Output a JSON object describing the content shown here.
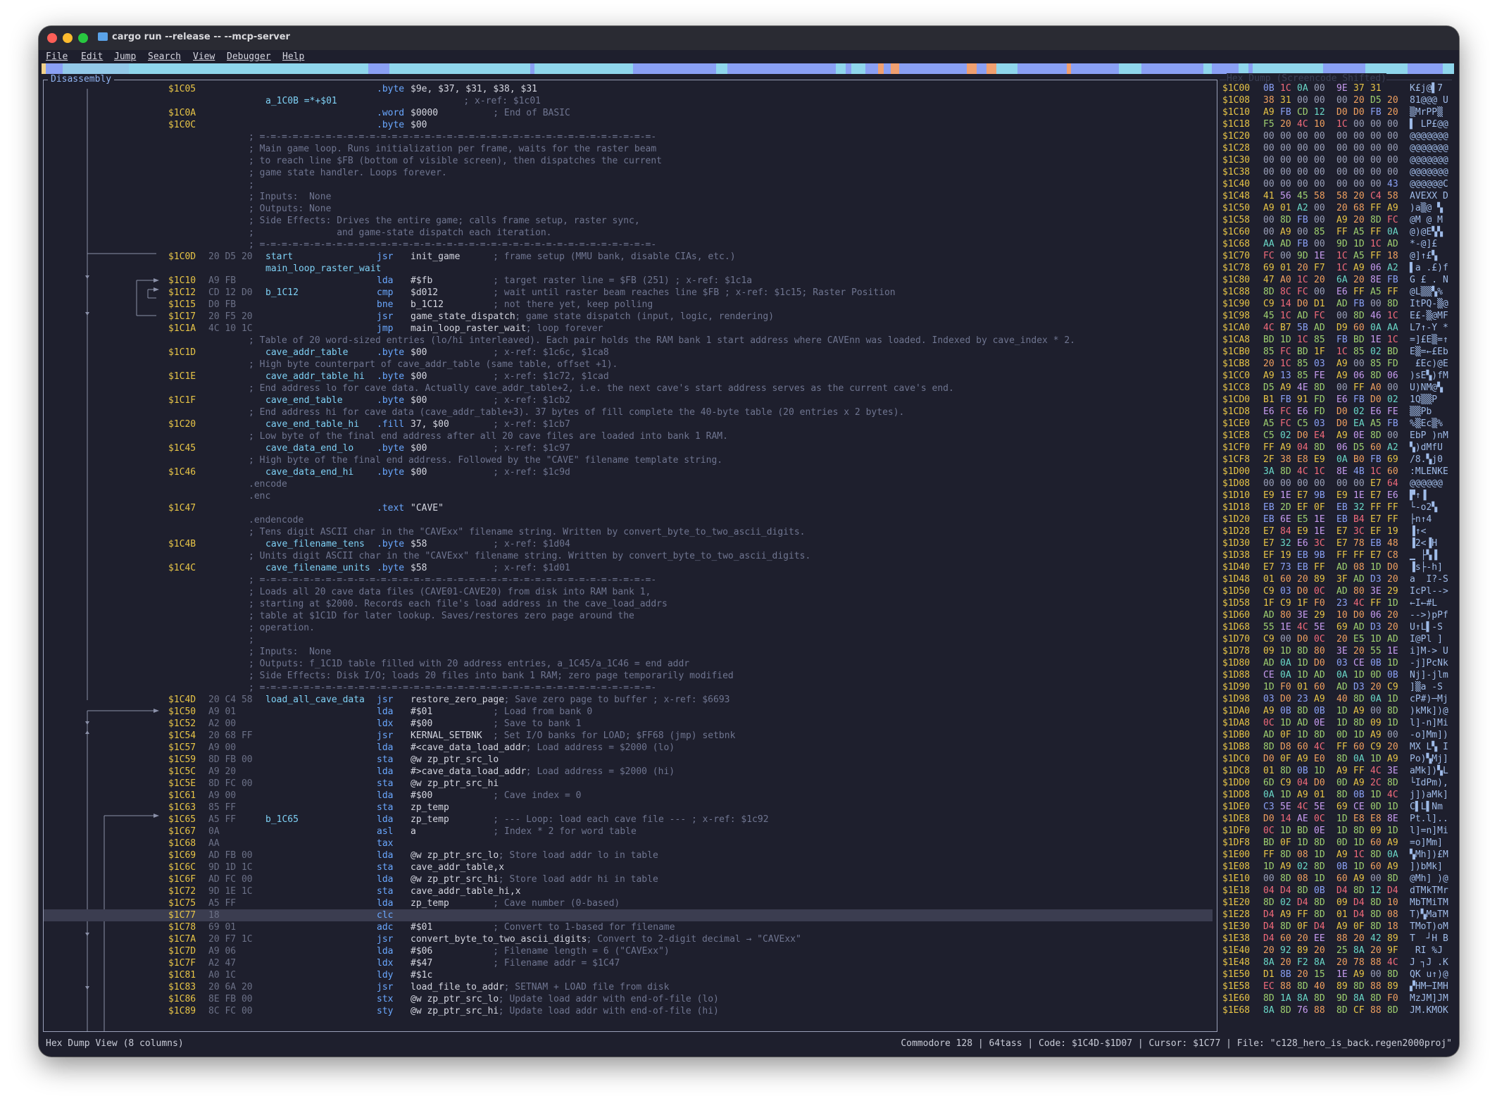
{
  "window": {
    "title": "cargo run --release -- --mcp-server"
  },
  "menu": [
    "File",
    "Edit",
    "Jump",
    "Search",
    "View",
    "Debugger",
    "Help"
  ],
  "panels": {
    "disassembly": "Disassembly",
    "hexdump": "Hex Dump (Screencode Shifted)"
  },
  "colors": {
    "address": "#e8c547",
    "label": "#7fd1f5",
    "mnemonic": "#6aa8ff",
    "comment": "#6f7590",
    "bytes": "#6b7086",
    "band": "#8aa0f4"
  },
  "lines": [
    {
      "a": "$1C05",
      "b": "",
      "l": "",
      "m": ".byte",
      "o": "$9e, $37, $31, $38, $31",
      "c": ""
    },
    {
      "a": "",
      "b": "",
      "l": "a_1C0B =*+$01",
      "m": "",
      "o": "",
      "c": "                       ; x-ref: $1c01"
    },
    {
      "a": "$1C0A",
      "b": "",
      "l": "",
      "m": ".word",
      "o": "$0000",
      "c": "          ; End of BASIC"
    },
    {
      "a": "$1C0C",
      "b": "",
      "l": "",
      "m": ".byte",
      "o": "$00",
      "c": ""
    },
    {
      "d": "; =-=-=-=-=-=-=-=-=-=-=-=-=-=-=-=-=-=-=-=-=-=-=-=-=-=-=-=-=-=-=-=-=-=-=-=-"
    },
    {
      "d": "; Main game loop. Runs initialization per frame, waits for the raster beam"
    },
    {
      "d": "; to reach line $FB (bottom of visible screen), then dispatches the current"
    },
    {
      "d": "; game state handler. Loops forever."
    },
    {
      "d": ";"
    },
    {
      "d": "; Inputs:  None"
    },
    {
      "d": "; Outputs: None"
    },
    {
      "d": "; Side Effects: Drives the entire game; calls frame setup, raster sync,"
    },
    {
      "d": ";               and game-state dispatch each iteration."
    },
    {
      "d": "; =-=-=-=-=-=-=-=-=-=-=-=-=-=-=-=-=-=-=-=-=-=-=-=-=-=-=-=-=-=-=-=-=-=-=-=-"
    },
    {
      "a": "$1C0D",
      "b": "20 D5 20",
      "l": "start",
      "m": "jsr",
      "o": "init_game",
      "c": "      ; frame setup (MMU bank, disable CIAs, etc.)"
    },
    {
      "a": "",
      "b": "",
      "l": "main_loop_raster_wait",
      "m": "",
      "o": "",
      "c": ""
    },
    {
      "a": "$1C10",
      "b": "A9 FB",
      "l": "",
      "m": "lda",
      "o": "#$fb",
      "c": "           ; target raster line = $FB (251) ; x-ref: $1c1a"
    },
    {
      "a": "$1C12",
      "b": "CD 12 D0",
      "l": "b_1C12",
      "m": "cmp",
      "o": "$d012",
      "c": "          ; wait until raster beam reaches line $FB ; x-ref: $1c15; Raster Position"
    },
    {
      "a": "$1C15",
      "b": "D0 FB",
      "l": "",
      "m": "bne",
      "o": "b_1C12",
      "c": "         ; not there yet, keep polling"
    },
    {
      "a": "$1C17",
      "b": "20 F5 20",
      "l": "",
      "m": "jsr",
      "o": "game_state_dispatch",
      "c": "; game state dispatch (input, logic, rendering)"
    },
    {
      "a": "$1C1A",
      "b": "4C 10 1C",
      "l": "",
      "m": "jmp",
      "o": "main_loop_raster_wait",
      "c": "; loop forever"
    },
    {
      "d": "; Table of 20 word-sized entries (lo/hi interleaved). Each pair holds the RAM bank 1 start address where CAVEnn was loaded. Indexed by cave_index * 2."
    },
    {
      "a": "$1C1D",
      "b": "",
      "l": "cave_addr_table",
      "m": ".byte",
      "o": "$00",
      "c": "            ; x-ref: $1c6c, $1ca8"
    },
    {
      "d": "; High byte counterpart of cave_addr_table (same table, offset +1)."
    },
    {
      "a": "$1C1E",
      "b": "",
      "l": "cave_addr_table_hi",
      "m": ".byte",
      "o": "$00",
      "c": "            ; x-ref: $1c72, $1cad"
    },
    {
      "d": "; End address lo for cave data. Actually cave_addr_table+2, i.e. the next cave's start address serves as the current cave's end."
    },
    {
      "a": "$1C1F",
      "b": "",
      "l": "cave_end_table",
      "m": ".byte",
      "o": "$00",
      "c": "            ; x-ref: $1cb2"
    },
    {
      "d": "; End address hi for cave data (cave_addr_table+3). 37 bytes of fill complete the 40-byte table (20 entries x 2 bytes)."
    },
    {
      "a": "$1C20",
      "b": "",
      "l": "cave_end_table_hi",
      "m": ".fill",
      "o": "37, $00",
      "c": "        ; x-ref: $1cb7"
    },
    {
      "d": "; Low byte of the final end address after all 20 cave files are loaded into bank 1 RAM."
    },
    {
      "a": "$1C45",
      "b": "",
      "l": "cave_data_end_lo",
      "m": ".byte",
      "o": "$00",
      "c": "            ; x-ref: $1c97"
    },
    {
      "d": "; High byte of the final end address. Followed by the \"CAVE\" filename template string."
    },
    {
      "a": "$1C46",
      "b": "",
      "l": "cave_data_end_hi",
      "m": ".byte",
      "o": "$00",
      "c": "            ; x-ref: $1c9d"
    },
    {
      "d": ".encode"
    },
    {
      "d": ".enc"
    },
    {
      "a": "$1C47",
      "b": "",
      "l": "",
      "m": ".text",
      "o": "\"CAVE\"",
      "c": ""
    },
    {
      "d": ".endencode"
    },
    {
      "d": "; Tens digit ASCII char in the \"CAVExx\" filename string. Written by convert_byte_to_two_ascii_digits."
    },
    {
      "a": "$1C4B",
      "b": "",
      "l": "cave_filename_tens",
      "m": ".byte",
      "o": "$58",
      "c": "            ; x-ref: $1d04"
    },
    {
      "d": "; Units digit ASCII char in the \"CAVExx\" filename string. Written by convert_byte_to_two_ascii_digits."
    },
    {
      "a": "$1C4C",
      "b": "",
      "l": "cave_filename_units",
      "m": ".byte",
      "o": "$58",
      "c": "            ; x-ref: $1d01"
    },
    {
      "d": "; =-=-=-=-=-=-=-=-=-=-=-=-=-=-=-=-=-=-=-=-=-=-=-=-=-=-=-=-=-=-=-=-=-=-=-=-"
    },
    {
      "d": "; Loads all 20 cave data files (CAVE01-CAVE20) from disk into RAM bank 1,"
    },
    {
      "d": "; starting at $2000. Records each file's load address in the cave_load_addrs"
    },
    {
      "d": "; table at $1C1D for later lookup. Saves/restores zero page around the"
    },
    {
      "d": "; operation."
    },
    {
      "d": ";"
    },
    {
      "d": "; Inputs:  None"
    },
    {
      "d": "; Outputs: f_1C1D table filled with 20 address entries, a_1C45/a_1C46 = end addr"
    },
    {
      "d": "; Side Effects: Disk I/O; loads 20 files into bank 1 RAM; zero page temporarily modified"
    },
    {
      "d": "; =-=-=-=-=-=-=-=-=-=-=-=-=-=-=-=-=-=-=-=-=-=-=-=-=-=-=-=-=-=-=-=-=-=-=-=-"
    },
    {
      "a": "$1C4D",
      "b": "20 C4 58",
      "l": "load_all_cave_data",
      "m": "jsr",
      "o": "restore_zero_page",
      "c": "; Save zero page to buffer ; x-ref: $6693"
    },
    {
      "a": "$1C50",
      "b": "A9 01",
      "l": "",
      "m": "lda",
      "o": "#$01",
      "c": "           ; Load from bank 0"
    },
    {
      "a": "$1C52",
      "b": "A2 00",
      "l": "",
      "m": "ldx",
      "o": "#$00",
      "c": "           ; Save to bank 1"
    },
    {
      "a": "$1C54",
      "b": "20 68 FF",
      "l": "",
      "m": "jsr",
      "o": "KERNAL_SETBNK",
      "c": "  ; Set I/O banks for LOAD; $FF68 (jmp) setbnk"
    },
    {
      "a": "$1C57",
      "b": "A9 00",
      "l": "",
      "m": "lda",
      "o": "#<cave_data_load_addr",
      "c": "; Load address = $2000 (lo)"
    },
    {
      "a": "$1C59",
      "b": "8D FB 00",
      "l": "",
      "m": "sta",
      "o": "@w zp_ptr_src_lo",
      "c": ""
    },
    {
      "a": "$1C5C",
      "b": "A9 20",
      "l": "",
      "m": "lda",
      "o": "#>cave_data_load_addr",
      "c": "; Load address = $2000 (hi)"
    },
    {
      "a": "$1C5E",
      "b": "8D FC 00",
      "l": "",
      "m": "sta",
      "o": "@w zp_ptr_src_hi",
      "c": ""
    },
    {
      "a": "$1C61",
      "b": "A9 00",
      "l": "",
      "m": "lda",
      "o": "#$00",
      "c": "           ; Cave index = 0"
    },
    {
      "a": "$1C63",
      "b": "85 FF",
      "l": "",
      "m": "sta",
      "o": "zp_temp",
      "c": ""
    },
    {
      "a": "$1C65",
      "b": "A5 FF",
      "l": "b_1C65",
      "m": "lda",
      "o": "zp_temp",
      "c": "        ; --- Loop: load each cave file --- ; x-ref: $1c92"
    },
    {
      "a": "$1C67",
      "b": "0A",
      "l": "",
      "m": "asl",
      "o": "a",
      "c": "              ; Index * 2 for word table"
    },
    {
      "a": "$1C68",
      "b": "AA",
      "l": "",
      "m": "tax",
      "o": "",
      "c": ""
    },
    {
      "a": "$1C69",
      "b": "AD FB 00",
      "l": "",
      "m": "lda",
      "o": "@w zp_ptr_src_lo",
      "c": "; Store load addr lo in table"
    },
    {
      "a": "$1C6C",
      "b": "9D 1D 1C",
      "l": "",
      "m": "sta",
      "o": "cave_addr_table,x",
      "c": ""
    },
    {
      "a": "$1C6F",
      "b": "AD FC 00",
      "l": "",
      "m": "lda",
      "o": "@w zp_ptr_src_hi",
      "c": "; Store load addr hi in table"
    },
    {
      "a": "$1C72",
      "b": "9D 1E 1C",
      "l": "",
      "m": "sta",
      "o": "cave_addr_table_hi,x",
      "c": ""
    },
    {
      "a": "$1C75",
      "b": "A5 FF",
      "l": "",
      "m": "lda",
      "o": "zp_temp",
      "c": "        ; Cave number (0-based)"
    },
    {
      "a": "$1C77",
      "b": "18",
      "l": "",
      "m": "clc",
      "o": "",
      "c": "",
      "hl": true
    },
    {
      "a": "$1C78",
      "b": "69 01",
      "l": "",
      "m": "adc",
      "o": "#$01",
      "c": "           ; Convert to 1-based for filename"
    },
    {
      "a": "$1C7A",
      "b": "20 F7 1C",
      "l": "",
      "m": "jsr",
      "o": "convert_byte_to_two_ascii_digits",
      "c": "; Convert to 2-digit decimal → \"CAVExx\""
    },
    {
      "a": "$1C7D",
      "b": "A9 06",
      "l": "",
      "m": "lda",
      "o": "#$06",
      "c": "           ; Filename length = 6 (\"CAVExx\")"
    },
    {
      "a": "$1C7F",
      "b": "A2 47",
      "l": "",
      "m": "ldx",
      "o": "#$47",
      "c": "           ; Filename addr = $1C47"
    },
    {
      "a": "$1C81",
      "b": "A0 1C",
      "l": "",
      "m": "ldy",
      "o": "#$1c",
      "c": ""
    },
    {
      "a": "$1C83",
      "b": "20 6A 20",
      "l": "",
      "m": "jsr",
      "o": "load_file_to_addr",
      "c": "; SETNAM + LOAD file from disk"
    },
    {
      "a": "$1C86",
      "b": "8E FB 00",
      "l": "",
      "m": "stx",
      "o": "@w zp_ptr_src_lo",
      "c": "; Update load addr with end-of-file (lo)"
    },
    {
      "a": "$1C89",
      "b": "8C FC 00",
      "l": "",
      "m": "sty",
      "o": "@w zp_ptr_src_hi",
      "c": "; Update load addr with end-of-file (hi)"
    }
  ],
  "hex": [
    [
      "$1C00",
      "0B 1C 0A 00 9E 37 31",
      "K£j@▌7"
    ],
    [
      "$1C08",
      "38 31 00 00 00 20 D5 20",
      "81@@@ U"
    ],
    [
      "$1C10",
      "A9 FB CD 12 D0 D0 FB 20",
      "▒MrPP▒"
    ],
    [
      "$1C18",
      "F5 20 4C 10 1C 00 00 00",
      "▌ LP£@@"
    ],
    [
      "$1C20",
      "00 00 00 00 00 00 00 00",
      "@@@@@@@"
    ],
    [
      "$1C28",
      "00 00 00 00 00 00 00 00",
      "@@@@@@@"
    ],
    [
      "$1C30",
      "00 00 00 00 00 00 00 00",
      "@@@@@@@"
    ],
    [
      "$1C38",
      "00 00 00 00 00 00 00 00",
      "@@@@@@@"
    ],
    [
      "$1C40",
      "00 00 00 00 00 00 00 43",
      "@@@@@@C"
    ],
    [
      "$1C48",
      "41 56 45 58 58 20 C4 58",
      "AVEXX D"
    ],
    [
      "$1C50",
      "A9 01 A2 00 20 68 FF A9",
      ")a▒@ ▚"
    ],
    [
      "$1C58",
      "00 8D FB 00 A9 20 8D FC",
      "@M @ M"
    ],
    [
      "$1C60",
      "00 A9 00 85 FF A5 FF 0A",
      "@)@E▚▚"
    ],
    [
      "$1C68",
      "AA AD FB 00 9D 1D 1C AD",
      "*-@]£"
    ],
    [
      "$1C70",
      "FC 00 9D 1E 1C A5 FF 18",
      "@]↑£▚"
    ],
    [
      "$1C78",
      "69 01 20 F7 1C A9 06 A2",
      "▌a .£)f"
    ],
    [
      "$1C80",
      "47 A0 1C 20 6A 20 8E FB",
      "G £ . N"
    ],
    [
      "$1C88",
      "8D 8C FC 00 E6 FF A5 FF",
      "@L▒▒▚%"
    ],
    [
      "$1C90",
      "C9 14 D0 D1 AD FB 00 8D",
      "ItPQ-▒@"
    ],
    [
      "$1C98",
      "45 1C AD FC 00 8D 46 1C",
      "E£-▒@MF"
    ],
    [
      "$1CA0",
      "4C B7 5B AD D9 60 0A AA",
      "L7↑-Y *"
    ],
    [
      "$1CA8",
      "BD 1D 1C 85 FB BD 1E 1C",
      "=]£E▒=↑"
    ],
    [
      "$1CB0",
      "85 FC BD 1F 1C 85 02 BD",
      "E▒=←£Eb"
    ],
    [
      "$1CB8",
      "20 1C 85 03 A9 00 85 FD",
      " £Ec)@E"
    ],
    [
      "$1CC0",
      "A9 13 85 FE A9 06 8D 06",
      ")sE▚)fM"
    ],
    [
      "$1CC8",
      "D5 A9 4E 8D 00 FF A0 00",
      "U)NM@▚"
    ],
    [
      "$1CD0",
      "B1 FB 91 FD E6 FB D0 02",
      "1Q▒▒P"
    ],
    [
      "$1CD8",
      "E6 FC E6 FD D0 02 E6 FE",
      "▒▒Pb"
    ],
    [
      "$1CE0",
      "A5 FC C5 03 D0 EA A5 FB",
      "%▒Ec▒%"
    ],
    [
      "$1CE8",
      "C5 02 D0 E4 A9 0E 8D 00",
      "EbP )nM"
    ],
    [
      "$1CF0",
      "FF A9 04 8D 06 D5 60 A2",
      "▚)dMfU"
    ],
    [
      "$1CF8",
      "2F 38 E8 E9 0A B0 FB 69",
      "/8.▚j0"
    ],
    [
      "$1D00",
      "3A 8D 4C 1C 8E 4B 1C 60",
      ":MLENKE"
    ],
    [
      "$1D08",
      "00 00 00 00 00 00 E7 64",
      "@@@@@@"
    ],
    [
      "$1D10",
      "E9 1E E7 9B E9 1E E7 E6",
      "▛↑▐"
    ],
    [
      "$1D18",
      "EB 2D EF 0F EB 32 FF FF",
      "└-o2▚"
    ],
    [
      "$1D20",
      "EB 6E E5 1E EB B4 E7 FF",
      "├n↑4"
    ],
    [
      "$1D28",
      "E7 84 E9 1E E7 3C EF 19",
      "▐↑<"
    ],
    [
      "$1D30",
      "E7 32 E6 3C E7 78 EB 48",
      "▐2<▐H"
    ],
    [
      "$1D38",
      "EF 19 EB 9B FF FF E7 C8",
      "▁ ├▚▐"
    ],
    [
      "$1D40",
      "E7 73 EB FF AD 08 1D D0",
      "▐s├-h]"
    ],
    [
      "$1D48",
      "01 60 20 89 3F AD D3 20",
      "a  I?-S"
    ],
    [
      "$1D50",
      "C9 03 D0 0C AD 80 3E 29",
      "IcPl-->"
    ],
    [
      "$1D58",
      "1F C9 1F F0 23 4C FF 1D",
      "←I←#L"
    ],
    [
      "$1D60",
      "AD 80 3E 29 10 D0 06 20",
      "-->)pPf"
    ],
    [
      "$1D68",
      "55 1E 4C 5E 69 AD D3 20",
      "U↑L▌-S"
    ],
    [
      "$1D70",
      "C9 00 D0 0C 20 E5 1D AD",
      "I@Pl ]"
    ],
    [
      "$1D78",
      "09 1D 8D 80 3E 20 55 1E",
      "i]M-> U"
    ],
    [
      "$1D80",
      "AD 0A 1D D0 03 CE 0B 1D",
      "-j]PcNk"
    ],
    [
      "$1D88",
      "CE 0A 1D AD 0A 1D 0D 0B",
      "Nj]-jlm"
    ],
    [
      "$1D90",
      "1D F0 01 60 AD D3 20 C9",
      "]▒a -S"
    ],
    [
      "$1D98",
      "03 D0 23 A9 40 8D 0A 1D",
      "cP#)─Mj"
    ],
    [
      "$1DA0",
      "A9 0B 8D 0B 1D A9 00 8D",
      ")kMk])@"
    ],
    [
      "$1DA8",
      "0C 1D AD 0E 1D 8D 09 1D",
      "l]-n]Mi"
    ],
    [
      "$1DB0",
      "AD 0F 1D 8D 0D 1D A9 00",
      "-o]Mm])"
    ],
    [
      "$1DB8",
      "8D D8 60 4C FF 60 C9 20",
      "MX L▚ I"
    ],
    [
      "$1DC0",
      "D0 0F A9 E0 8D 0A 1D A9",
      "Po)▚Mj]"
    ],
    [
      "$1DC8",
      "01 8D 0B 1D A9 FF 4C 3E",
      "aMk])▚L"
    ],
    [
      "$1DD0",
      "6D C9 04 D0 0D A9 2C 8D",
      "└IdPm),"
    ],
    [
      "$1DD8",
      "0A 1D A9 01 8D 0B 1D 4C",
      "j])aMk]"
    ],
    [
      "$1DE0",
      "C3 5E 4C 5E 69 CE 0D 1D",
      "C▌L▌Nm"
    ],
    [
      "$1DE8",
      "D0 14 AE 0C 1D E8 E8 8E",
      "Pt.l].."
    ],
    [
      "$1DF0",
      "0C 1D BD 0E 1D 8D 09 1D",
      "l]=n]Mi"
    ],
    [
      "$1DF8",
      "BD 0F 1D 8D 0D 1D 60 A9",
      "=o]Mm]"
    ],
    [
      "$1E00",
      "FF 8D 08 1D A9 1C 8D 0A",
      "▚Mh])£M"
    ],
    [
      "$1E08",
      "1D A9 02 8D 0B 1D 60 A9",
      "])bMk]"
    ],
    [
      "$1E10",
      "00 8D 08 1D 60 A9 00 8D",
      "@Mh] )@"
    ],
    [
      "$1E18",
      "04 D4 8D 0B D4 8D 12 D4",
      "dTMkTMr"
    ],
    [
      "$1E20",
      "8D 02 D4 8D 09 D4 8D 10",
      "MbTMiTM"
    ],
    [
      "$1E28",
      "D4 A9 FF 8D 01 D4 8D 08",
      "T)▚MaTM"
    ],
    [
      "$1E30",
      "D4 8D 0F D4 A9 0F 8D 18",
      "TMoT)oM"
    ],
    [
      "$1E38",
      "D4 60 20 EE 88 20 42 89",
      "T  ┘H B"
    ],
    [
      "$1E40",
      "20 92 89 20 25 8A 20 9F",
      " RI %J"
    ],
    [
      "$1E48",
      "8A 20 F2 8A 20 78 88 4C",
      "J ┐J .K"
    ],
    [
      "$1E50",
      "D1 8B 20 15 1E A9 00 8D",
      "QK u↑)@"
    ],
    [
      "$1E58",
      "EC 88 8D 40 89 8D 88 89",
      "▞HM─IMH"
    ],
    [
      "$1E60",
      "8D 1A 8A 8D 9D 8A 8D F0",
      "MzJM]JM"
    ],
    [
      "$1E68",
      "8A 8D 76 88 8D CF 88 8D",
      "JM.KMOK"
    ]
  ],
  "status": {
    "left": "Hex Dump View (8 columns)",
    "right": "Commodore 128 | 64tass | Code: $1C4D-$1D07 | Cursor: $1C77 | File: \"c128_hero_is_back.regen2000proj\""
  }
}
